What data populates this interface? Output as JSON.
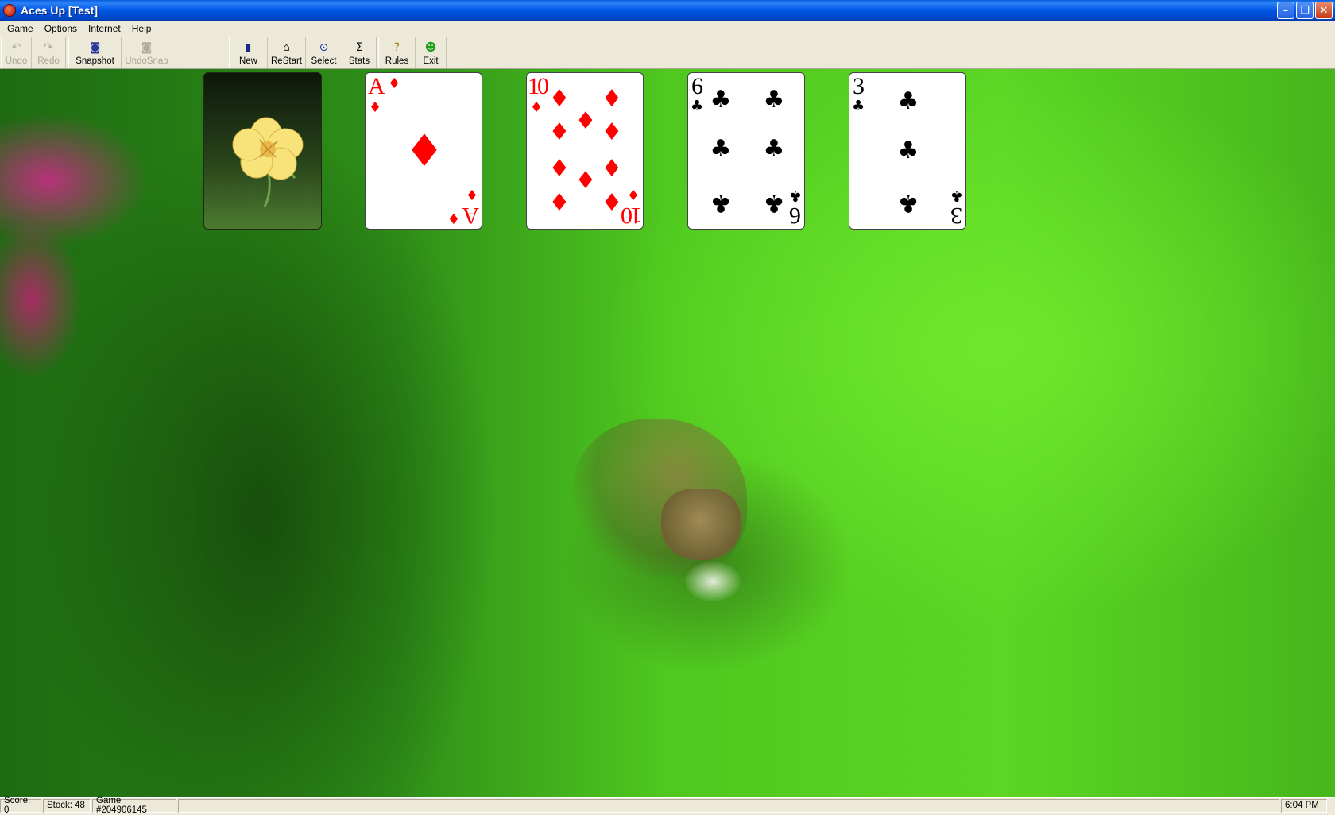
{
  "window": {
    "title": "Aces Up [Test]"
  },
  "menu": {
    "items": [
      "Game",
      "Options",
      "Internet",
      "Help"
    ]
  },
  "toolbar": {
    "undo": "Undo",
    "redo": "Redo",
    "snapshot": "Snapshot",
    "undosnap": "UndoSnap",
    "new": "New",
    "restart": "ReStart",
    "select": "Select",
    "stats": "Stats",
    "rules": "Rules",
    "exit": "Exit"
  },
  "cards": [
    {
      "rank": "A",
      "suit": "diamond"
    },
    {
      "rank": "10",
      "suit": "diamond"
    },
    {
      "rank": "6",
      "suit": "club"
    },
    {
      "rank": "3",
      "suit": "club"
    }
  ],
  "status": {
    "score": "Score:  0",
    "stock": "Stock: 48",
    "game": "Game #204906145",
    "time": "6:04 PM"
  },
  "colors": {
    "red_suit": "#ff0000",
    "black_suit": "#000000",
    "title_bar": "#0055e5"
  }
}
